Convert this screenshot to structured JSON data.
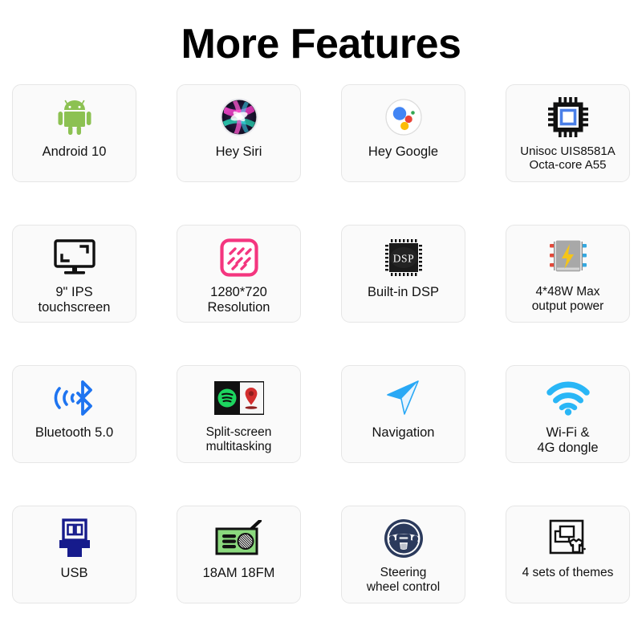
{
  "header": {
    "title": "More Features"
  },
  "features": [
    {
      "icon": "android-robot-icon",
      "label": "Android 10",
      "size": "normal"
    },
    {
      "icon": "siri-orb-icon",
      "label": "Hey Siri",
      "size": "normal"
    },
    {
      "icon": "google-assistant-icon",
      "label": "Hey Google",
      "size": "normal"
    },
    {
      "icon": "cpu-chip-icon",
      "label": "Unisoc UIS8581A\nOcta-core A55",
      "size": "xsmall"
    },
    {
      "icon": "monitor-screen-icon",
      "label": "9\" IPS\ntouchscreen",
      "size": "normal"
    },
    {
      "icon": "resolution-pattern-icon",
      "label": "1280*720\nResolution",
      "size": "normal"
    },
    {
      "icon": "dsp-chip-icon",
      "label": "Built-in DSP",
      "size": "normal"
    },
    {
      "icon": "amplifier-power-icon",
      "label": "4*48W Max\noutput power",
      "size": "small"
    },
    {
      "icon": "bluetooth-icon",
      "label": "Bluetooth 5.0",
      "size": "normal"
    },
    {
      "icon": "split-screen-icon",
      "label": "Split-screen\nmultitasking",
      "size": "small"
    },
    {
      "icon": "navigation-arrow-icon",
      "label": "Navigation",
      "size": "normal"
    },
    {
      "icon": "wifi-icon",
      "label": "Wi-Fi &\n4G dongle",
      "size": "normal"
    },
    {
      "icon": "usb-connector-icon",
      "label": "USB",
      "size": "normal"
    },
    {
      "icon": "radio-icon",
      "label": "18AM 18FM",
      "size": "normal"
    },
    {
      "icon": "steering-wheel-icon",
      "label": "Steering\nwheel control",
      "size": "small"
    },
    {
      "icon": "themes-icon",
      "label": "4 sets of themes",
      "size": "small"
    }
  ],
  "colors": {
    "android_green": "#8CC152",
    "chip_blue": "#4A7FE8",
    "resolution_pink": "#F4367F",
    "amp_yellow": "#F5C518",
    "bluetooth_blue": "#1E74F0",
    "spotify_green": "#1DD65F",
    "map_pin_red": "#D32F2F",
    "nav_blue": "#29A8F5",
    "wifi_blue": "#29B6F6",
    "usb_navy": "#161B8C",
    "radio_green": "#8BD97E",
    "steering_navy": "#2B3A5C",
    "card_bg": "#FAFAFA",
    "card_border": "#E6E6E6"
  }
}
